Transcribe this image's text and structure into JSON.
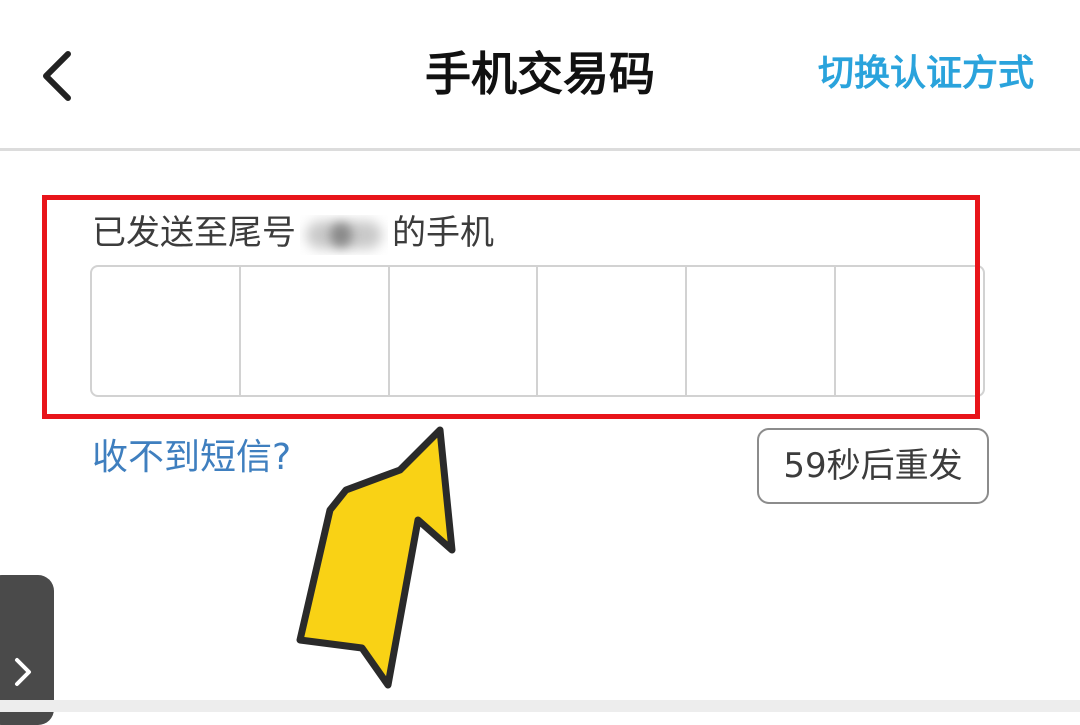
{
  "header": {
    "title": "手机交易码",
    "switch_label": "切换认证方式"
  },
  "sms": {
    "hint_prefix": "已发送至尾号",
    "masked_digits": "****",
    "hint_suffix": "的手机"
  },
  "code_input": {
    "length": 6
  },
  "actions": {
    "help_label": "收不到短信?",
    "resend_label": "59秒后重发",
    "resend_countdown_seconds": 59
  },
  "colors": {
    "accent_link": "#2aa3dc",
    "help_link": "#3f7fbf",
    "highlight_border": "#e8141a",
    "arrow_fill": "#f9d215"
  },
  "icons": {
    "back": "chevron-left-icon",
    "side_tab": "chevron-right-icon",
    "annotation": "pointer-arrow-icon"
  }
}
